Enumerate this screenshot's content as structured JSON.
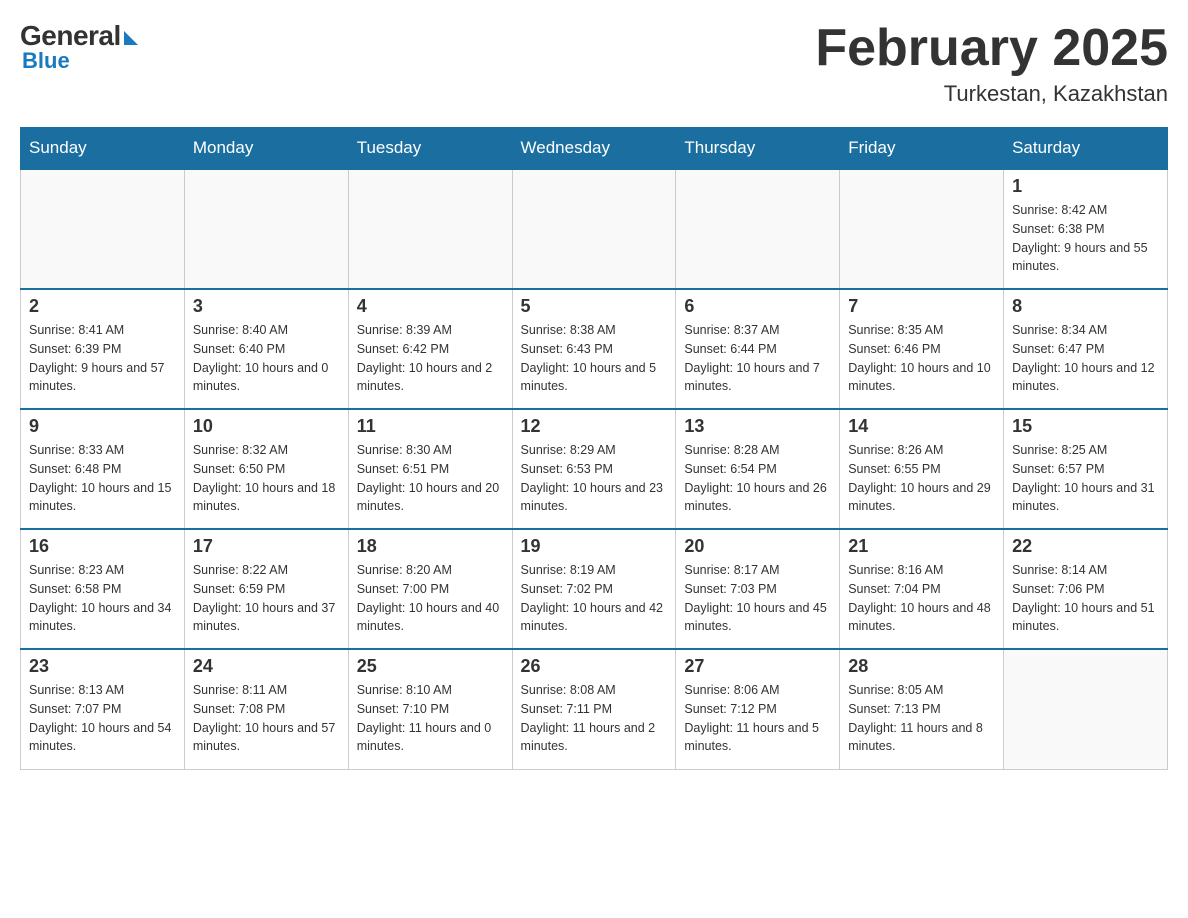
{
  "header": {
    "logo": {
      "general_text": "General",
      "blue_text": "Blue"
    },
    "title": "February 2025",
    "location": "Turkestan, Kazakhstan"
  },
  "calendar": {
    "days_of_week": [
      "Sunday",
      "Monday",
      "Tuesday",
      "Wednesday",
      "Thursday",
      "Friday",
      "Saturday"
    ],
    "weeks": [
      [
        {
          "day": "",
          "info": ""
        },
        {
          "day": "",
          "info": ""
        },
        {
          "day": "",
          "info": ""
        },
        {
          "day": "",
          "info": ""
        },
        {
          "day": "",
          "info": ""
        },
        {
          "day": "",
          "info": ""
        },
        {
          "day": "1",
          "info": "Sunrise: 8:42 AM\nSunset: 6:38 PM\nDaylight: 9 hours and 55 minutes."
        }
      ],
      [
        {
          "day": "2",
          "info": "Sunrise: 8:41 AM\nSunset: 6:39 PM\nDaylight: 9 hours and 57 minutes."
        },
        {
          "day": "3",
          "info": "Sunrise: 8:40 AM\nSunset: 6:40 PM\nDaylight: 10 hours and 0 minutes."
        },
        {
          "day": "4",
          "info": "Sunrise: 8:39 AM\nSunset: 6:42 PM\nDaylight: 10 hours and 2 minutes."
        },
        {
          "day": "5",
          "info": "Sunrise: 8:38 AM\nSunset: 6:43 PM\nDaylight: 10 hours and 5 minutes."
        },
        {
          "day": "6",
          "info": "Sunrise: 8:37 AM\nSunset: 6:44 PM\nDaylight: 10 hours and 7 minutes."
        },
        {
          "day": "7",
          "info": "Sunrise: 8:35 AM\nSunset: 6:46 PM\nDaylight: 10 hours and 10 minutes."
        },
        {
          "day": "8",
          "info": "Sunrise: 8:34 AM\nSunset: 6:47 PM\nDaylight: 10 hours and 12 minutes."
        }
      ],
      [
        {
          "day": "9",
          "info": "Sunrise: 8:33 AM\nSunset: 6:48 PM\nDaylight: 10 hours and 15 minutes."
        },
        {
          "day": "10",
          "info": "Sunrise: 8:32 AM\nSunset: 6:50 PM\nDaylight: 10 hours and 18 minutes."
        },
        {
          "day": "11",
          "info": "Sunrise: 8:30 AM\nSunset: 6:51 PM\nDaylight: 10 hours and 20 minutes."
        },
        {
          "day": "12",
          "info": "Sunrise: 8:29 AM\nSunset: 6:53 PM\nDaylight: 10 hours and 23 minutes."
        },
        {
          "day": "13",
          "info": "Sunrise: 8:28 AM\nSunset: 6:54 PM\nDaylight: 10 hours and 26 minutes."
        },
        {
          "day": "14",
          "info": "Sunrise: 8:26 AM\nSunset: 6:55 PM\nDaylight: 10 hours and 29 minutes."
        },
        {
          "day": "15",
          "info": "Sunrise: 8:25 AM\nSunset: 6:57 PM\nDaylight: 10 hours and 31 minutes."
        }
      ],
      [
        {
          "day": "16",
          "info": "Sunrise: 8:23 AM\nSunset: 6:58 PM\nDaylight: 10 hours and 34 minutes."
        },
        {
          "day": "17",
          "info": "Sunrise: 8:22 AM\nSunset: 6:59 PM\nDaylight: 10 hours and 37 minutes."
        },
        {
          "day": "18",
          "info": "Sunrise: 8:20 AM\nSunset: 7:00 PM\nDaylight: 10 hours and 40 minutes."
        },
        {
          "day": "19",
          "info": "Sunrise: 8:19 AM\nSunset: 7:02 PM\nDaylight: 10 hours and 42 minutes."
        },
        {
          "day": "20",
          "info": "Sunrise: 8:17 AM\nSunset: 7:03 PM\nDaylight: 10 hours and 45 minutes."
        },
        {
          "day": "21",
          "info": "Sunrise: 8:16 AM\nSunset: 7:04 PM\nDaylight: 10 hours and 48 minutes."
        },
        {
          "day": "22",
          "info": "Sunrise: 8:14 AM\nSunset: 7:06 PM\nDaylight: 10 hours and 51 minutes."
        }
      ],
      [
        {
          "day": "23",
          "info": "Sunrise: 8:13 AM\nSunset: 7:07 PM\nDaylight: 10 hours and 54 minutes."
        },
        {
          "day": "24",
          "info": "Sunrise: 8:11 AM\nSunset: 7:08 PM\nDaylight: 10 hours and 57 minutes."
        },
        {
          "day": "25",
          "info": "Sunrise: 8:10 AM\nSunset: 7:10 PM\nDaylight: 11 hours and 0 minutes."
        },
        {
          "day": "26",
          "info": "Sunrise: 8:08 AM\nSunset: 7:11 PM\nDaylight: 11 hours and 2 minutes."
        },
        {
          "day": "27",
          "info": "Sunrise: 8:06 AM\nSunset: 7:12 PM\nDaylight: 11 hours and 5 minutes."
        },
        {
          "day": "28",
          "info": "Sunrise: 8:05 AM\nSunset: 7:13 PM\nDaylight: 11 hours and 8 minutes."
        },
        {
          "day": "",
          "info": ""
        }
      ]
    ]
  }
}
